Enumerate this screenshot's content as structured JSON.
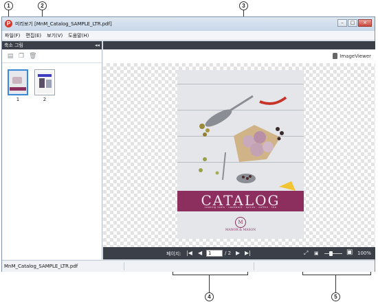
{
  "window": {
    "title": "미리보기 [MnM_Catalog_SAMPLE_LTR.pdf]",
    "app_icon_glyph": "P",
    "controls": {
      "minimize": "–",
      "maximize": "□",
      "close": "×"
    }
  },
  "menu": [
    "파일(F)",
    "편집(E)",
    "보기(V)",
    "도움말(H)"
  ],
  "sidebar": {
    "title": "축소 그림",
    "collapse_glyph": "◂◂",
    "tools": [
      {
        "icon": "print-icon",
        "glyph": "▤"
      },
      {
        "icon": "copy-icon",
        "glyph": "❐"
      },
      {
        "icon": "trash-icon",
        "glyph": "🗑"
      }
    ],
    "thumbnails": [
      {
        "label": "1",
        "selected": true
      },
      {
        "label": "2",
        "selected": false
      }
    ]
  },
  "viewer": {
    "label": "ImageViewer",
    "page": {
      "title": "CATALOG",
      "subtitle": "cooking tools · cookware · spices · coffee · tea",
      "logo_glyph": "M",
      "brand": "MANOR & MASON",
      "accent": "#8c2f5f"
    }
  },
  "navigation": {
    "label": "페이지:",
    "first_glyph": "|◀",
    "prev_glyph": "◀",
    "current_page": "1",
    "total": "/ 2",
    "next_glyph": "▶",
    "last_glyph": "▶|",
    "fit_glyph": "⤢",
    "small_image_glyph": "▣",
    "large_image_glyph": "▣",
    "zoom_fraction": 0.35,
    "zoom": "100%"
  },
  "status": {
    "filename": "MnM_Catalog_SAMPLE_LTR.pdf"
  },
  "callouts": [
    "1",
    "2",
    "3",
    "4",
    "5"
  ]
}
